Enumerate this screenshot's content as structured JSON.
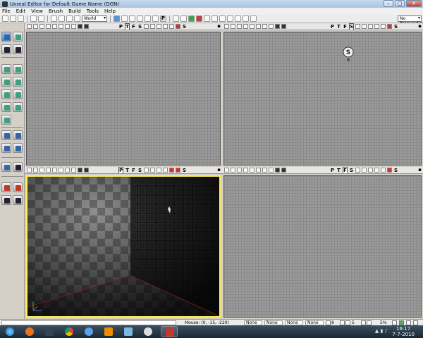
{
  "window": {
    "title": "Unreal Editor for Default Game Name (DGN)"
  },
  "menu": [
    "File",
    "Edit",
    "View",
    "Brush",
    "Build",
    "Tools",
    "Help"
  ],
  "toolbar": {
    "coord_system": "World",
    "propagation": "No Propagation"
  },
  "viewport_toolbar": {
    "letters": [
      "P",
      "T",
      "F",
      "S"
    ],
    "right_label": "S"
  },
  "viewports": [
    {
      "name": "top",
      "selected_letter": "T"
    },
    {
      "name": "side",
      "selected_letter": "S"
    },
    {
      "name": "perspective",
      "selected_letter": "P"
    },
    {
      "name": "front",
      "selected_letter": "F"
    }
  ],
  "status": {
    "mouse": "Mouse: (0, -15, -220)",
    "slots": [
      "None",
      "None",
      "None",
      "None"
    ],
    "grid": "8",
    "rotation": "5",
    "scale": "5%"
  },
  "taskbar": {
    "time": "16:17",
    "date": "7-7-2010"
  },
  "colors": {
    "selected_viewport": "#ffee55",
    "viewport_grid": "#9a9a9a"
  }
}
